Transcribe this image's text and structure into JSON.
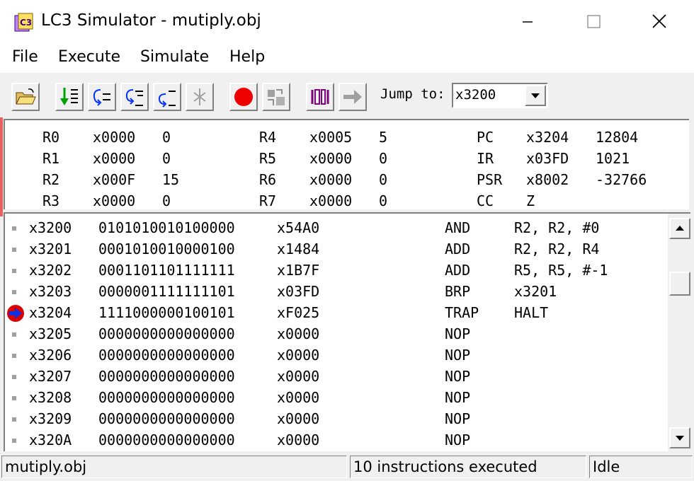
{
  "window": {
    "title": "LC3 Simulator - mutiply.obj"
  },
  "menu": {
    "items": [
      "File",
      "Execute",
      "Simulate",
      "Help"
    ]
  },
  "toolbar": {
    "buttons": [
      {
        "name": "open-file",
        "icon": "open-folder-icon"
      },
      {
        "name": "run",
        "icon": "run-icon"
      },
      {
        "name": "step-over",
        "icon": "step-over-icon"
      },
      {
        "name": "step-into",
        "icon": "step-into-icon"
      },
      {
        "name": "step-out",
        "icon": "step-out-icon"
      },
      {
        "name": "stop",
        "icon": "stop-icon"
      },
      {
        "name": "breakpoint",
        "icon": "breakpoint-icon"
      },
      {
        "name": "memory-settings",
        "icon": "memory-settings-icon"
      },
      {
        "name": "console",
        "icon": "console-icon"
      },
      {
        "name": "jump",
        "icon": "jump-arrow-icon"
      }
    ],
    "jump_label": "Jump to:",
    "jump_value": "x3200"
  },
  "registers": [
    {
      "name": "R0",
      "hex": "x0000",
      "dec": "0"
    },
    {
      "name": "R1",
      "hex": "x0000",
      "dec": "0"
    },
    {
      "name": "R2",
      "hex": "x000F",
      "dec": "15"
    },
    {
      "name": "R3",
      "hex": "x0000",
      "dec": "0"
    },
    {
      "name": "R4",
      "hex": "x0005",
      "dec": "5"
    },
    {
      "name": "R5",
      "hex": "x0000",
      "dec": "0"
    },
    {
      "name": "R6",
      "hex": "x0000",
      "dec": "0"
    },
    {
      "name": "R7",
      "hex": "x0000",
      "dec": "0"
    },
    {
      "name": "PC",
      "hex": "x3204",
      "dec": "12804"
    },
    {
      "name": "IR",
      "hex": "x03FD",
      "dec": "1021"
    },
    {
      "name": "PSR",
      "hex": "x8002",
      "dec": "-32766"
    },
    {
      "name": "CC",
      "hex": "Z",
      "dec": ""
    }
  ],
  "code": [
    {
      "addr": "x3200",
      "bin": "0101010010100000",
      "hex": "x54A0",
      "op": "AND",
      "args": "R2, R2, #0",
      "pc": false
    },
    {
      "addr": "x3201",
      "bin": "0001010010000100",
      "hex": "x1484",
      "op": "ADD",
      "args": "R2, R2, R4",
      "pc": false
    },
    {
      "addr": "x3202",
      "bin": "0001101101111111",
      "hex": "x1B7F",
      "op": "ADD",
      "args": "R5, R5, #-1",
      "pc": false
    },
    {
      "addr": "x3203",
      "bin": "0000001111111101",
      "hex": "x03FD",
      "op": "BRP",
      "args": "x3201",
      "pc": false
    },
    {
      "addr": "x3204",
      "bin": "1111000000100101",
      "hex": "xF025",
      "op": "TRAP",
      "args": "HALT",
      "pc": true
    },
    {
      "addr": "x3205",
      "bin": "0000000000000000",
      "hex": "x0000",
      "op": "NOP",
      "args": "",
      "pc": false
    },
    {
      "addr": "x3206",
      "bin": "0000000000000000",
      "hex": "x0000",
      "op": "NOP",
      "args": "",
      "pc": false
    },
    {
      "addr": "x3207",
      "bin": "0000000000000000",
      "hex": "x0000",
      "op": "NOP",
      "args": "",
      "pc": false
    },
    {
      "addr": "x3208",
      "bin": "0000000000000000",
      "hex": "x0000",
      "op": "NOP",
      "args": "",
      "pc": false
    },
    {
      "addr": "x3209",
      "bin": "0000000000000000",
      "hex": "x0000",
      "op": "NOP",
      "args": "",
      "pc": false
    },
    {
      "addr": "x320A",
      "bin": "0000000000000000",
      "hex": "x0000",
      "op": "NOP",
      "args": "",
      "pc": false
    }
  ],
  "status": {
    "file": "mutiply.obj",
    "executed": "10 instructions executed",
    "state": "Idle"
  }
}
